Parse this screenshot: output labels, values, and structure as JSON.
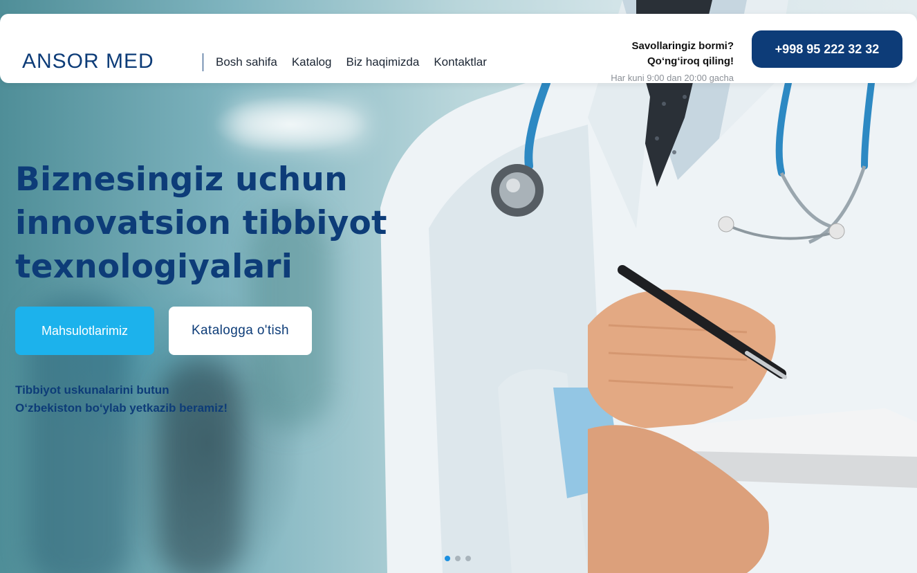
{
  "header": {
    "logo": "ANSOR MED",
    "nav": [
      "Bosh sahifa",
      "Katalog",
      "Biz haqimizda",
      "Kontaktlar"
    ],
    "contact": {
      "question": "Savollaringiz bormi?",
      "call": "Qo‘ng‘iroq qiling!",
      "hours": "Har kuni 9:00 dan 20:00 gacha"
    },
    "phone": "+998 95 222 32 32"
  },
  "hero": {
    "title": "Biznesingiz uchun innovatsion tibbiyot texnologiyalari",
    "primary_button": "Mahsulotlarimiz",
    "secondary_button": "Katalogga o'tish",
    "tagline_line1": "Tibbiyot uskunalarini butun",
    "tagline_line2": "O‘zbekiston bo‘ylab yetkazib beramiz!"
  },
  "carousel": {
    "slides": 3,
    "active": 1
  },
  "colors": {
    "brand": "#0d3c78",
    "accent": "#1cb2ec",
    "dot_active": "#1a8fe0"
  },
  "icons": [
    "stethoscope-illustration",
    "pen-illustration",
    "notebook-illustration"
  ]
}
